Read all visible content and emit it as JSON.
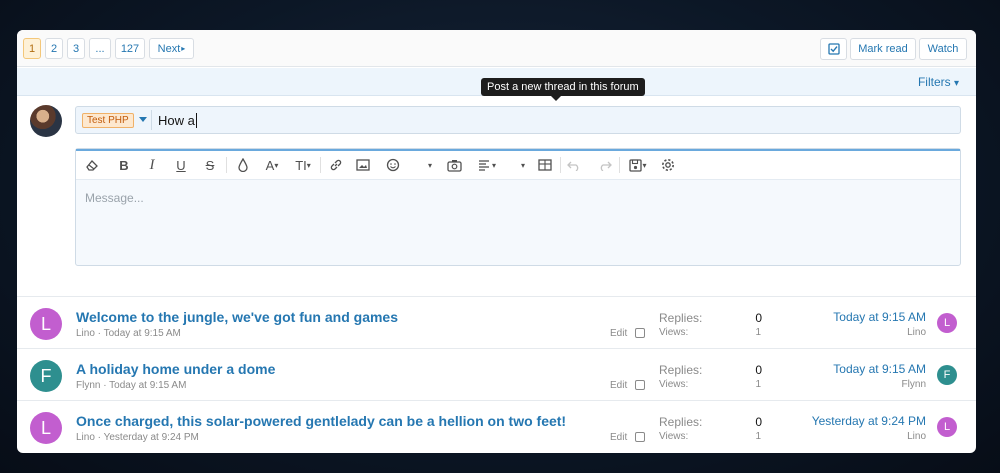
{
  "pagination": {
    "pages": [
      "1",
      "2",
      "3",
      "...",
      "127"
    ],
    "next_label": "Next",
    "next_arrow": "▸"
  },
  "actions": {
    "mark_read": "Mark read",
    "watch": "Watch"
  },
  "filters": {
    "label": "Filters",
    "caret": "▾"
  },
  "tooltip": "Post a new thread in this forum",
  "composer": {
    "prefix": "Test PHP",
    "title_value": "How a",
    "message_placeholder": "Message..."
  },
  "threads": [
    {
      "avatar_letter": "L",
      "avatar_color": "#c25ecf",
      "title": "Welcome to the jungle, we've got fun and games",
      "meta": "Lino · Today at 9:15 AM",
      "edit": "Edit",
      "replies_label": "Replies:",
      "replies": "0",
      "views_label": "Views:",
      "views": "1",
      "last_date": "Today at 9:15 AM",
      "last_user": "Lino"
    },
    {
      "avatar_letter": "F",
      "avatar_color": "#2e8f8f",
      "title": "A holiday home under a dome",
      "meta": "Flynn · Today at 9:15 AM",
      "edit": "Edit",
      "replies_label": "Replies:",
      "replies": "0",
      "views_label": "Views:",
      "views": "1",
      "last_date": "Today at 9:15 AM",
      "last_user": "Flynn"
    },
    {
      "avatar_letter": "L",
      "avatar_color": "#c25ecf",
      "title": "Once charged, this solar-powered gentlelady can be a hellion on two feet!",
      "meta": "Lino · Yesterday at 9:24 PM",
      "edit": "Edit",
      "replies_label": "Replies:",
      "replies": "0",
      "views_label": "Views:",
      "views": "1",
      "last_date": "Yesterday at 9:24 PM",
      "last_user": "Lino"
    }
  ],
  "colors": {
    "link": "#2577b1",
    "active_page_bg": "#fef1d7",
    "filter_bar_bg": "#edf5fc"
  },
  "toolbar_icons": [
    "eraser-icon",
    "bold-icon",
    "italic-icon",
    "underline-icon",
    "strikethrough-icon",
    "text-color-icon",
    "font-family-icon",
    "font-size-icon",
    "link-icon",
    "image-icon",
    "emoji-icon",
    "camera-icon",
    "align-icon",
    "table-icon",
    "undo-icon",
    "redo-icon",
    "drafts-icon",
    "settings-icon"
  ]
}
